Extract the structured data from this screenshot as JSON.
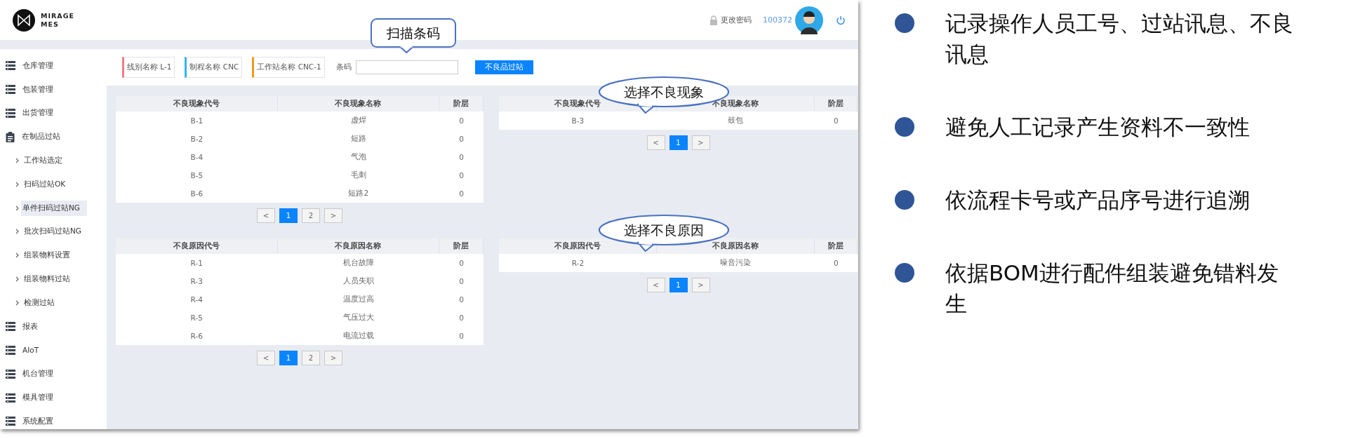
{
  "header": {
    "logo_lines": [
      "MIRAGE",
      "MES"
    ],
    "change_password": "更改密码",
    "user_id": "100372"
  },
  "sidebar": {
    "items": [
      {
        "label": "仓库管理"
      },
      {
        "label": "包装管理"
      },
      {
        "label": "出货管理"
      },
      {
        "label": "在制品过站",
        "children": [
          {
            "label": "工作站选定",
            "selected": false
          },
          {
            "label": "扫码过站OK",
            "selected": false
          },
          {
            "label": "单件扫码过站NG",
            "selected": true
          },
          {
            "label": "批次扫码过站NG",
            "selected": false
          },
          {
            "label": "组装物料设置",
            "selected": false
          },
          {
            "label": "组装物料过站",
            "selected": false
          },
          {
            "label": "检测过站",
            "selected": false
          }
        ]
      },
      {
        "label": "报表"
      },
      {
        "label": "AIoT"
      },
      {
        "label": "机台管理"
      },
      {
        "label": "模具管理"
      },
      {
        "label": "系统配置"
      }
    ]
  },
  "filters": {
    "tags": [
      {
        "label": "线别名称 L-1",
        "color": "#f27b86"
      },
      {
        "label": "制程名称 CNC",
        "color": "#2fb6f2"
      },
      {
        "label": "工作站名称 CNC-1",
        "color": "#f59a1b"
      }
    ],
    "barcode_label": "条码",
    "button": "不良品过站"
  },
  "tables": [
    {
      "columns": [
        "不良现象代号",
        "不良现象名称",
        "阶层"
      ],
      "rows": [
        [
          "B-1",
          "虚焊",
          "0"
        ],
        [
          "B-2",
          "短路",
          "0"
        ],
        [
          "B-4",
          "气泡",
          "0"
        ],
        [
          "B-5",
          "毛刺",
          "0"
        ],
        [
          "B-6",
          "短路2",
          "0"
        ]
      ],
      "pager": [
        {
          "label": "<",
          "selected": false
        },
        {
          "label": "1",
          "selected": true
        },
        {
          "label": "2",
          "selected": false
        },
        {
          "label": ">",
          "selected": false
        }
      ]
    },
    {
      "columns": [
        "不良现象代号",
        "不良现象名称",
        "阶层"
      ],
      "rows": [
        [
          "B-3",
          "鼓包",
          "0"
        ]
      ],
      "pager": [
        {
          "label": "<",
          "selected": false
        },
        {
          "label": "1",
          "selected": true
        },
        {
          "label": ">",
          "selected": false
        }
      ]
    },
    {
      "columns": [
        "不良原因代号",
        "不良原因名称",
        "阶层"
      ],
      "rows": [
        [
          "R-1",
          "机台故障",
          "0"
        ],
        [
          "R-3",
          "人员失职",
          "0"
        ],
        [
          "R-4",
          "温度过高",
          "0"
        ],
        [
          "R-5",
          "气压过大",
          "0"
        ],
        [
          "R-6",
          "电流过载",
          "0"
        ]
      ],
      "pager": [
        {
          "label": "<",
          "selected": false
        },
        {
          "label": "1",
          "selected": true
        },
        {
          "label": "2",
          "selected": false
        },
        {
          "label": ">",
          "selected": false
        }
      ]
    },
    {
      "columns": [
        "不良原因代号",
        "不良原因名称",
        "阶层"
      ],
      "rows": [
        [
          "R-2",
          "噪音污染",
          "0"
        ]
      ],
      "pager": [
        {
          "label": "<",
          "selected": false
        },
        {
          "label": "1",
          "selected": true
        },
        {
          "label": ">",
          "selected": false
        }
      ]
    }
  ],
  "callouts": [
    "扫描条码",
    "选择不良现象",
    "选择不良原因"
  ],
  "bullets": [
    "记录操作人员工号、过站讯息、不良讯息",
    "避免人工记录产生资料不一致性",
    "依流程卡号或产品序号进行追溯",
    "依据BOM进行配件组装避免错料发生"
  ]
}
